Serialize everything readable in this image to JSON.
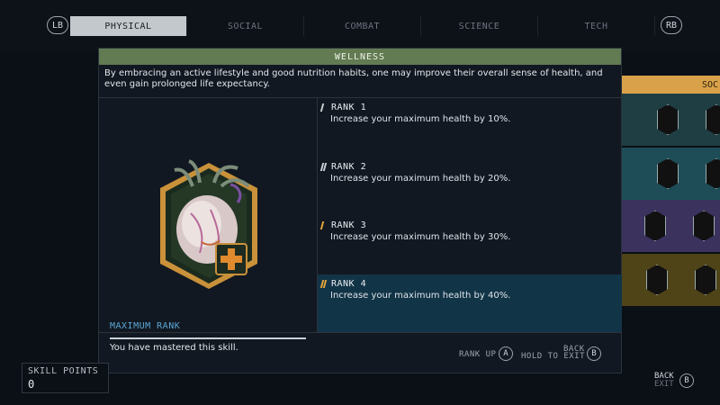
{
  "nav": {
    "lb": "LB",
    "rb": "RB",
    "tabs": [
      {
        "label": "PHYSICAL",
        "active": true
      },
      {
        "label": "SOCIAL",
        "active": false
      },
      {
        "label": "COMBAT",
        "active": false
      },
      {
        "label": "SCIENCE",
        "active": false
      },
      {
        "label": "TECH",
        "active": false
      }
    ]
  },
  "background": {
    "category_label": "SOC"
  },
  "modal": {
    "title": "WELLNESS",
    "description": "By embracing an active lifestyle and good nutrition habits, one may improve their overall sense of health, and even gain prolonged life expectancy.",
    "max_rank": {
      "title": "MAXIMUM RANK",
      "text": "You have mastered this skill."
    },
    "ranks": [
      {
        "title": "RANK 1",
        "text": "Increase your maximum health by 10%.",
        "selected": false
      },
      {
        "title": "RANK 2",
        "text": "Increase your maximum health by 20%.",
        "selected": false
      },
      {
        "title": "RANK 3",
        "text": "Increase your maximum health by 30%.",
        "selected": false
      },
      {
        "title": "RANK 4",
        "text": "Increase your maximum health by 40%.",
        "selected": true
      }
    ],
    "footer": {
      "rank_up_label": "RANK UP",
      "rank_up_button": "A",
      "back_label": "BACK",
      "hold_to_exit": "HOLD TO EXIT",
      "back_button": "B"
    }
  },
  "skill_points": {
    "label": "SKILL POINTS",
    "value": "0"
  },
  "outer_back": {
    "back": "BACK",
    "exit": "EXIT",
    "button": "B"
  },
  "colors": {
    "header_green": "#637b52",
    "accent_gold": "#e0a43a",
    "selected_row": "#123447",
    "max_rank_blue": "#5aa8d6"
  }
}
